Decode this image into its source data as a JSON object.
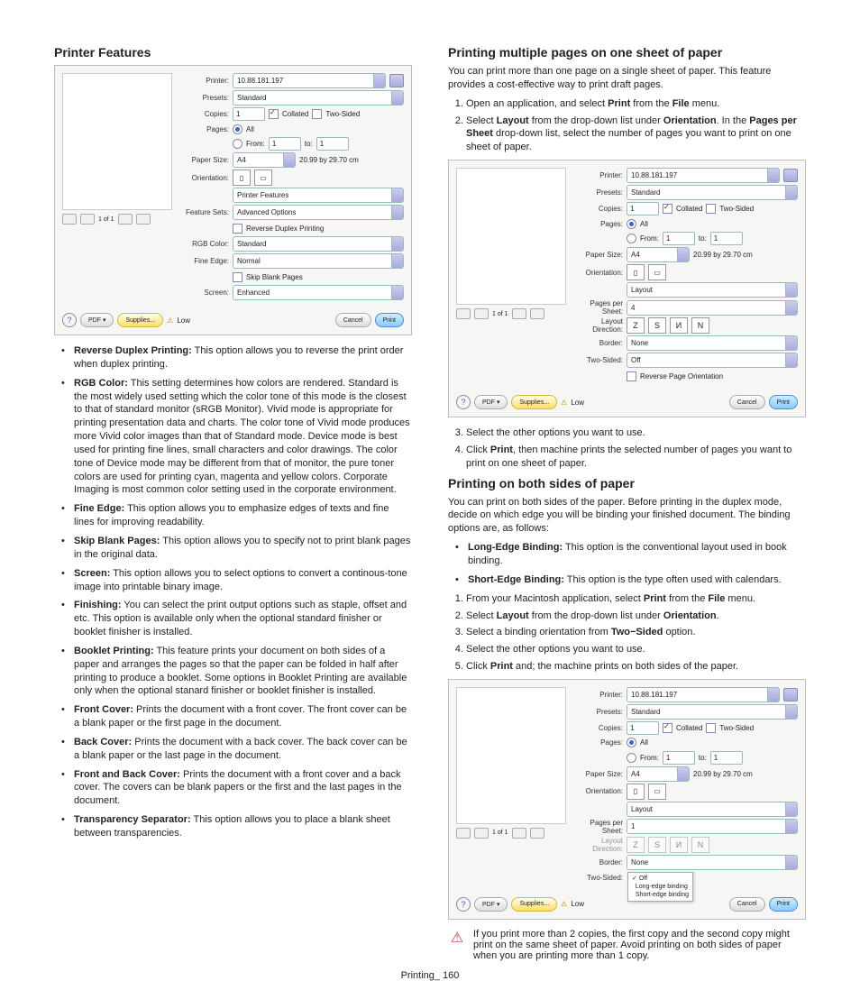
{
  "left": {
    "heading": "Printer Features",
    "bullets": [
      {
        "t": "Reverse Duplex Printing:",
        "d": "  This option allows you to reverse the print order when duplex printing."
      },
      {
        "t": "RGB Color:",
        "d": "  This setting determines how colors are rendered. Standard is the most widely used setting which the color tone of this mode is the closest to that of standard monitor (sRGB Monitor). Vivid mode is appropriate for printing presentation data and charts. The color tone of Vivid mode produces more Vivid color images than that of Standard mode. Device mode is best used for printing fine lines, small characters and color drawings. The color tone of Device mode may be different from that of monitor, the pure toner colors are used for printing cyan, magenta and yellow colors. Corporate Imaging is most common color setting used in the corporate environment."
      },
      {
        "t": "Fine Edge:",
        "d": "  This option allows you to emphasize edges of texts and fine lines for improving readability."
      },
      {
        "t": "Skip Blank Pages:",
        "d": "  This option allows you to specify not to print blank pages in the original data."
      },
      {
        "t": "Screen:",
        "d": "  This option allows you to select options to convert a continous-tone image into printable binary image."
      },
      {
        "t": "Finishing:",
        "d": "  You can select the print output options such as staple, offset and etc. This option is available only when the optional standard finisher or booklet finisher is installed."
      },
      {
        "t": "Booklet Printing:",
        "d": "  This feature prints your document on both sides of a paper and arranges the pages so that the paper can be folded in half after printing to produce a booklet. Some options in Booklet Printing are available only when the optional stanard finisher or booklet finisher is installed."
      },
      {
        "t": "Front Cover:",
        "d": "  Prints the document with a front cover. The front cover can be a blank paper or the first page in the document."
      },
      {
        "t": "Back Cover:",
        "d": "  Prints the document with a back cover. The back cover can be a blank paper or the last page in the document."
      },
      {
        "t": "Front and Back Cover:",
        "d": "  Prints the document with a front cover and a back cover. The covers can be blank papers or the first and the last pages in the document."
      },
      {
        "t": "Transparency Separator:",
        "d": "  This option allows you to place a blank sheet between transparencies."
      }
    ]
  },
  "right": {
    "h1": "Printing multiple pages on one sheet of paper",
    "p1": "You can print more than one page on a single sheet of paper. This feature provides a cost-effective way to print draft pages.",
    "ol1": [
      "Open an application, and select Print from the File menu.",
      "Select Layout from the drop-down list under Orientation. In the Pages per Sheet drop-down list, select the number of pages you want to print on one sheet of paper."
    ],
    "ol1b": [
      "Select the other options you want to use.",
      "Click Print, then machine prints the selected number of pages you want to print on one sheet of paper."
    ],
    "h2": "Printing on both sides of paper",
    "p2": "You can print on both sides of the paper. Before printing in the duplex mode, decide on which edge you will be binding your finished document. The binding options are, as follows:",
    "bullets2": [
      {
        "t": "Long-Edge Binding:",
        "d": "  This option is the conventional layout used in book binding."
      },
      {
        "t": "Short-Edge Binding:",
        "d": "  This option is the type often used with calendars."
      }
    ],
    "ol2": [
      "From your Macintosh application, select Print from the File menu.",
      "Select Layout from the drop-down list under Orientation.",
      "Select a binding orientation from Two−Sided option.",
      "Select the other options you want to use.",
      "Click Print and; the machine prints on both sides of the paper."
    ],
    "warn": "If you print more than 2 copies, the first copy and the second copy might print on the same sheet of paper. Avoid printing on both sides of paper when you are printing more than 1 copy."
  },
  "dialog": {
    "printer_lbl": "Printer:",
    "printer_val": "10.88.181.197",
    "presets_lbl": "Presets:",
    "presets_val": "Standard",
    "copies_lbl": "Copies:",
    "copies_val": "1",
    "collated": "Collated",
    "twosided": "Two-Sided",
    "pages_lbl": "Pages:",
    "all": "All",
    "from": "From:",
    "from_v": "1",
    "to": "to:",
    "to_v": "1",
    "paper_lbl": "Paper Size:",
    "paper_val": "A4",
    "paper_dim": "20.99 by 29.70 cm",
    "orient_lbl": "Orientation:",
    "feature_tab": "Printer Features",
    "featureset_lbl": "Feature Sets:",
    "featureset_val": "Advanced Options",
    "reverse": "Reverse Duplex Printing",
    "rgb_lbl": "RGB Color:",
    "rgb_val": "Standard",
    "fine_lbl": "Fine Edge:",
    "fine_val": "Normal",
    "skip": "Skip Blank Pages",
    "screen_lbl": "Screen:",
    "screen_val": "Enhanced",
    "layout_tab": "Layout",
    "pps_lbl": "Pages per Sheet:",
    "pps_val4": "4",
    "pps_val1": "1",
    "ld_lbl": "Layout Direction:",
    "border_lbl": "Border:",
    "border_val": "None",
    "ts_lbl": "Two-Sided:",
    "ts_val": "Off",
    "rpo": "Reverse Page Orientation",
    "ts_off": "Off",
    "ts_long": "Long-edge binding",
    "ts_short": "Short-edge binding",
    "nav": "1 of 1",
    "pdf": "PDF ▾",
    "supplies": "Supplies...",
    "low": "Low",
    "cancel": "Cancel",
    "print": "Print"
  },
  "footer": "Printing_ 160"
}
